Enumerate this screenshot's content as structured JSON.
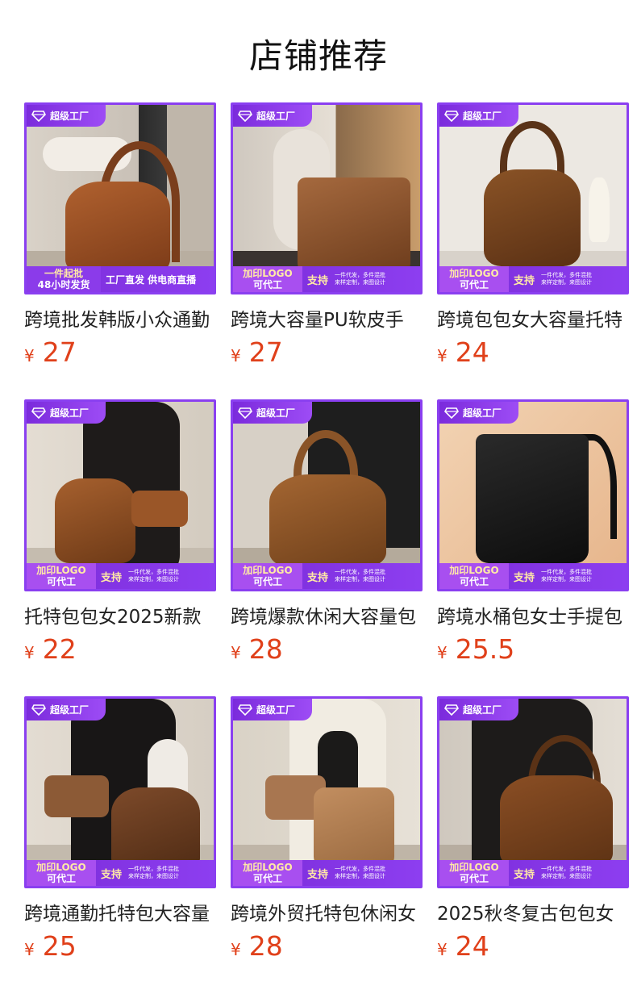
{
  "page": {
    "title": "店铺推荐"
  },
  "badge": {
    "top_label": "超级工厂"
  },
  "banners": {
    "primary": {
      "left_line1": "加印LOGO",
      "left_line2": "可代工",
      "middle": "支持",
      "right_line1": "一件代发，多件混批",
      "right_line2": "来样定制，来图设计"
    },
    "first": {
      "left_line1": "一件起批",
      "left_line2": "48小时发货",
      "middle": "工厂直发 供电商直播"
    }
  },
  "currency": "¥",
  "products": [
    {
      "title": "跨境批发韩版小众通勤",
      "price": "27"
    },
    {
      "title": "跨境大容量PU软皮手",
      "price": "27"
    },
    {
      "title": "跨境包包女大容量托特",
      "price": "24"
    },
    {
      "title": "托特包包女2025新款",
      "price": "22"
    },
    {
      "title": "跨境爆款休闲大容量包",
      "price": "28"
    },
    {
      "title": "跨境水桶包女士手提包",
      "price": "25.5"
    },
    {
      "title": "跨境通勤托特包大容量",
      "price": "25"
    },
    {
      "title": "跨境外贸托特包休闲女",
      "price": "28"
    },
    {
      "title": "2025秋冬复古包包女",
      "price": "24"
    }
  ],
  "colors": {
    "accent_purple": "#8a3ff0",
    "price_orange": "#e0401a"
  },
  "icons": {
    "badge_icon": "diamond-icon"
  }
}
